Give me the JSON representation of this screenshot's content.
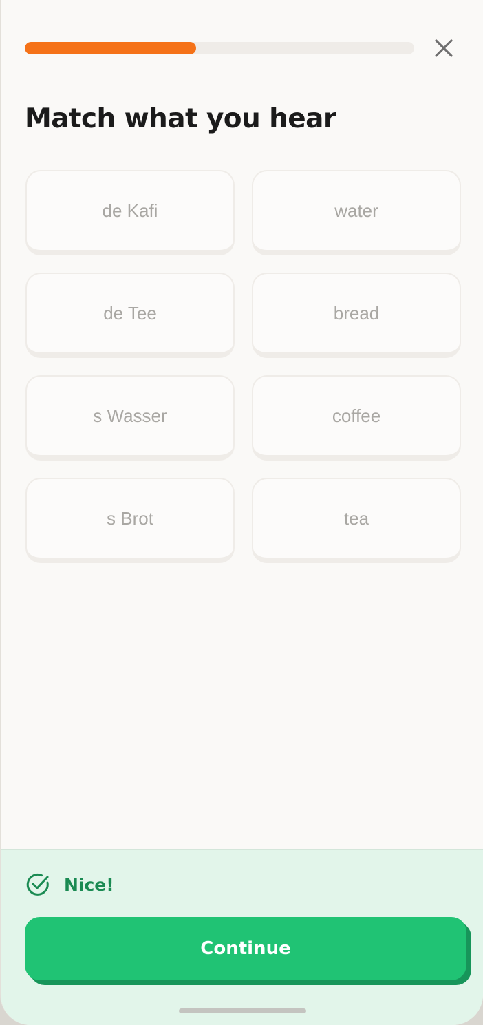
{
  "progress": {
    "fraction": 0.44
  },
  "header": {
    "close_icon": "close-icon"
  },
  "lesson": {
    "title": "Match what you hear",
    "tiles": {
      "left": [
        "de Kafi",
        "de Tee",
        "s Wasser",
        "s Brot"
      ],
      "right": [
        "water",
        "bread",
        "coffee",
        "tea"
      ]
    }
  },
  "feedback": {
    "icon": "check-circle-icon",
    "text": "Nice!",
    "continue_label": "Continue"
  },
  "colors": {
    "progress_accent": "#f57218",
    "success_green": "#20c374",
    "success_text": "#1a8a52",
    "sheet_background": "#e2f5ea"
  }
}
